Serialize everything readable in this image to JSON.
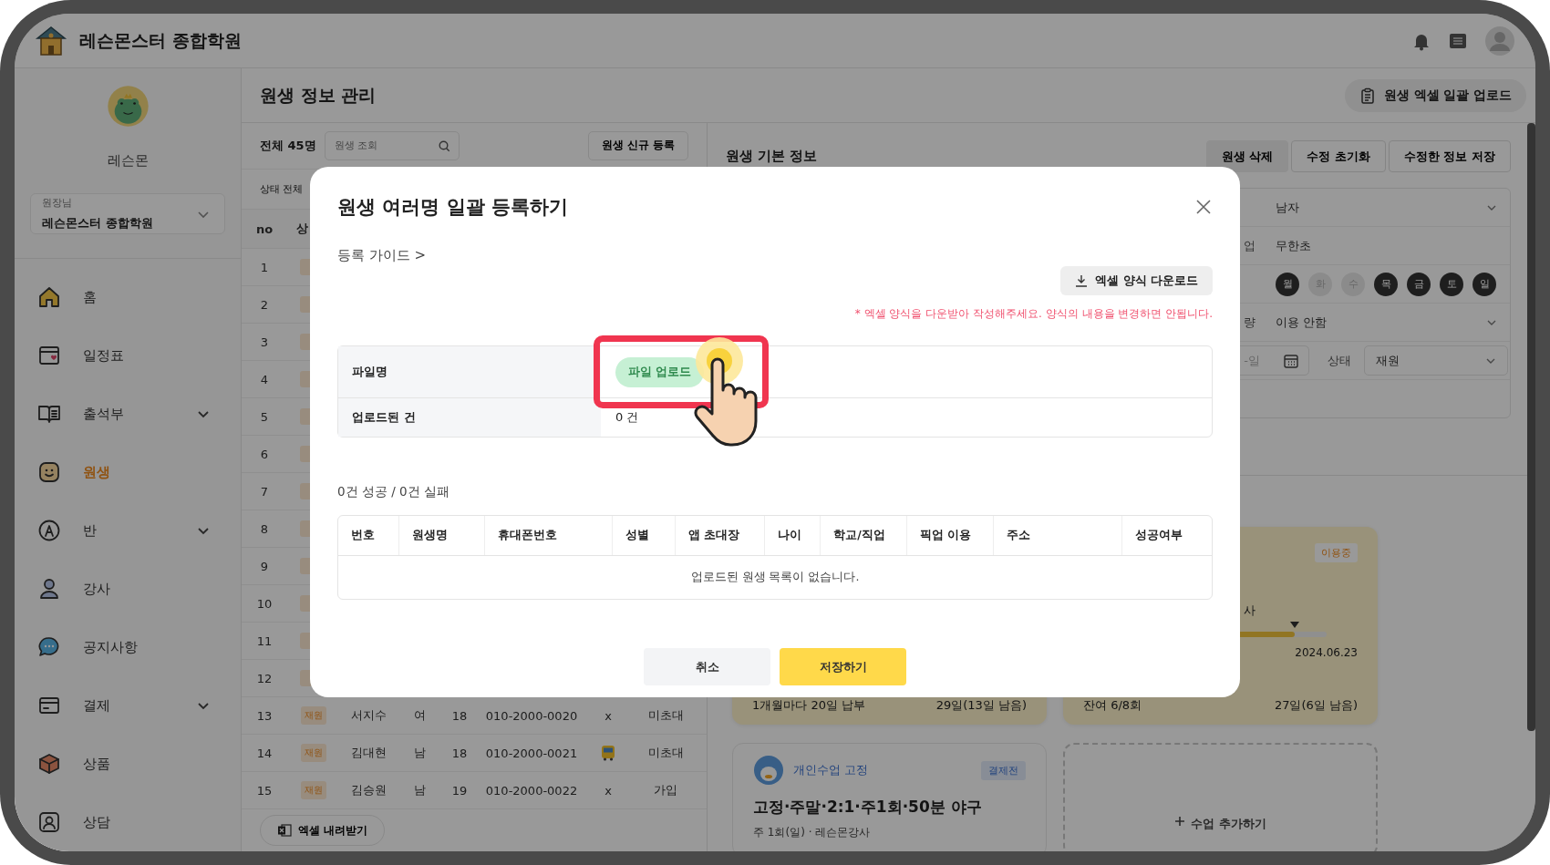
{
  "app_header": {
    "title": "레슨몬스터 종합학원"
  },
  "sidebar": {
    "profile_name": "레슨몬",
    "academy_selector": {
      "role": "원장님",
      "name": "레슨몬스터 종합학원"
    },
    "items": [
      {
        "label": "홈",
        "selected": false,
        "expandable": false
      },
      {
        "label": "일정표",
        "selected": false,
        "expandable": false
      },
      {
        "label": "출석부",
        "selected": false,
        "expandable": true
      },
      {
        "label": "원생",
        "selected": true,
        "expandable": false
      },
      {
        "label": "반",
        "selected": false,
        "expandable": true
      },
      {
        "label": "강사",
        "selected": false,
        "expandable": false
      },
      {
        "label": "공지사항",
        "selected": false,
        "expandable": false
      },
      {
        "label": "결제",
        "selected": false,
        "expandable": true
      },
      {
        "label": "상품",
        "selected": false,
        "expandable": false
      },
      {
        "label": "상담",
        "selected": false,
        "expandable": false
      }
    ]
  },
  "page": {
    "title": "원생 정보 관리",
    "bulk_upload_button": "원생 엑셀 일괄 업로드"
  },
  "student_list": {
    "total": "전체 45명",
    "search": {
      "placeholder": "원생 조회"
    },
    "new_button": "원생 신규 등록",
    "status_filter": "상태 전체",
    "columns": [
      "no",
      "상"
    ],
    "rows": [
      {
        "no": "1"
      },
      {
        "no": "2"
      },
      {
        "no": "3"
      },
      {
        "no": "4"
      },
      {
        "no": "5"
      },
      {
        "no": "6"
      },
      {
        "no": "7"
      },
      {
        "no": "8"
      },
      {
        "no": "9"
      },
      {
        "no": "10"
      },
      {
        "no": "11"
      },
      {
        "no": "12"
      },
      {
        "no": "13",
        "status": "재원",
        "name": "서지수",
        "gender": "여",
        "age": "18",
        "phone": "010-2000-0020",
        "pickup": {
          "kind": "text",
          "text": "x"
        },
        "app": "미초대"
      },
      {
        "no": "14",
        "status": "재원",
        "name": "김대현",
        "gender": "남",
        "age": "18",
        "phone": "010-2000-0021",
        "pickup": {
          "kind": "bus"
        },
        "app": "미초대"
      },
      {
        "no": "15",
        "status": "재원",
        "name": "김승원",
        "gender": "남",
        "age": "19",
        "phone": "010-2000-0022",
        "pickup": {
          "kind": "text",
          "text": "x"
        },
        "app": "가입"
      }
    ],
    "export_button": "엑셀 내려받기"
  },
  "student_info": {
    "title": "원생 기본 정보",
    "buttons": [
      {
        "label": "원생 삭제",
        "kind": "filled"
      },
      {
        "label": "수정 초기화",
        "kind": "outline"
      },
      {
        "label": "수정한 정보 저장",
        "kind": "outline"
      }
    ],
    "form_rows": [
      {
        "kind": "select",
        "value": "남자"
      },
      {
        "kind": "text",
        "label": "업",
        "value": "무한초"
      },
      {
        "kind": "days",
        "days": [
          {
            "label": "월",
            "selected": true
          },
          {
            "label": "화",
            "selected": false
          },
          {
            "label": "수",
            "selected": false
          },
          {
            "label": "목",
            "selected": true
          },
          {
            "label": "금",
            "selected": true
          },
          {
            "label": "토",
            "selected": true
          },
          {
            "label": "일",
            "selected": true
          }
        ]
      },
      {
        "kind": "select",
        "label": "량",
        "value": "이용 안함"
      },
      {
        "kind": "date_status",
        "date_placeholder": "-일",
        "status_label": "상태",
        "status_value": "재원"
      },
      {
        "kind": "empty"
      }
    ]
  },
  "cards": [
    {
      "kind": "plan",
      "left_text": "1개월마다 20일 납부",
      "right_text": "29일(13일 남음)"
    },
    {
      "kind": "pass",
      "badge": "이용중",
      "fragment": "사",
      "level": 0.87,
      "date": "2024.06.23",
      "left_text": "잔여 6/8회",
      "right_text": "27일(6일 남음)"
    },
    {
      "kind": "lesson",
      "type": "개인수업 고정",
      "badge": "결제전",
      "title": "고정·주말·2:1·주1회·50분 야구",
      "detail": "주 1회(일) · 레슨몬강사"
    },
    {
      "kind": "add",
      "label": "수업 추가하기"
    }
  ],
  "dialog": {
    "title": "원생 여러명 일괄 등록하기",
    "guide_link": "등록 가이드 >",
    "download_button": "엑셀 양식 다운로드",
    "notice": "* 엑셀 양식을 다운받아 작성해주세요. 양식의 내용을 변경하면 안됩니다.",
    "file_rows": [
      {
        "label": "파일명",
        "kind": "upload",
        "button": "파일 업로드"
      },
      {
        "label": "업로드된 건",
        "kind": "text",
        "value": "0 건"
      }
    ],
    "result_summary": "0건 성공 / 0건 실패",
    "result_columns": [
      "번호",
      "원생명",
      "휴대폰번호",
      "성별",
      "앱 초대장",
      "나이",
      "학교/직업",
      "픽업 이용",
      "주소",
      "성공여부"
    ],
    "empty_message": "업로드된 원생 목록이 없습니다.",
    "cancel_button": "취소",
    "save_button": "저장하기"
  }
}
